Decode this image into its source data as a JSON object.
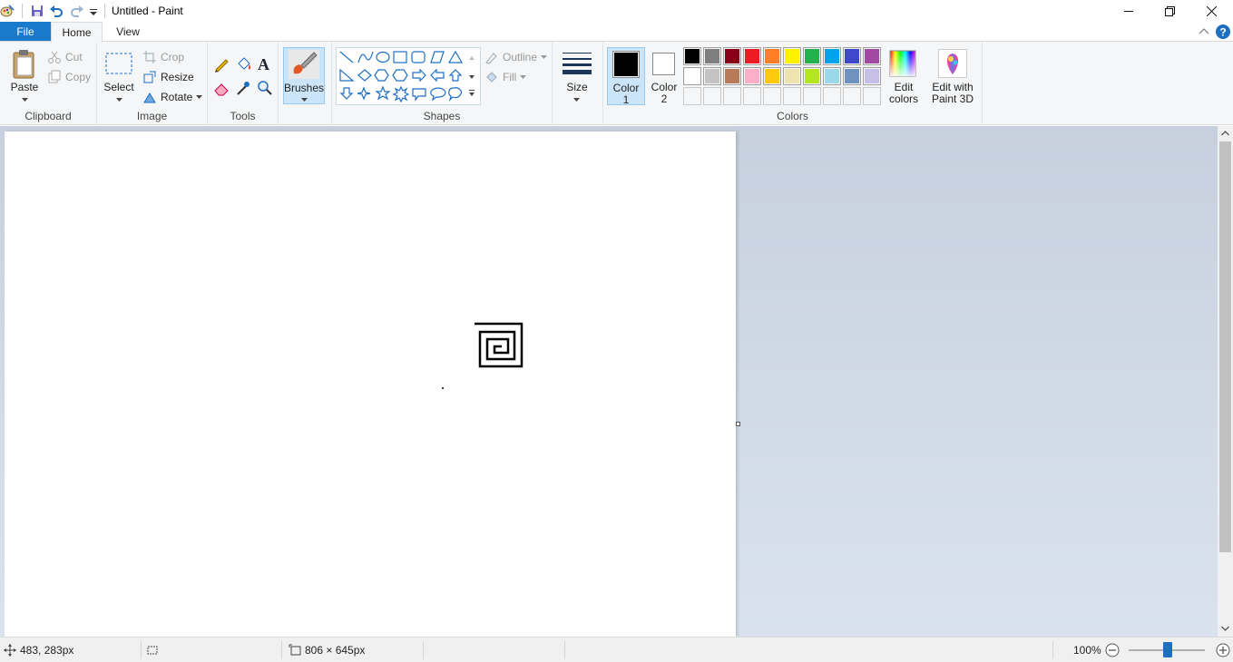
{
  "window": {
    "title": "Untitled - Paint",
    "quick_access": [
      "save-icon",
      "undo-icon",
      "redo-icon",
      "customize-icon"
    ]
  },
  "tabs": {
    "file": "File",
    "home": "Home",
    "view": "View"
  },
  "clipboard": {
    "paste": "Paste",
    "cut": "Cut",
    "copy": "Copy",
    "group": "Clipboard"
  },
  "image": {
    "select": "Select",
    "crop": "Crop",
    "resize": "Resize",
    "rotate": "Rotate",
    "group": "Image"
  },
  "tools": {
    "group": "Tools"
  },
  "brushes": {
    "label": "Brushes"
  },
  "shapes": {
    "outline": "Outline",
    "fill": "Fill",
    "group": "Shapes"
  },
  "size": {
    "label": "Size"
  },
  "colors": {
    "color1_a": "Color",
    "color1_b": "1",
    "color2_a": "Color",
    "color2_b": "2",
    "edit_a": "Edit",
    "edit_b": "colors",
    "group": "Colors",
    "color1": "#000000",
    "color2": "#ffffff",
    "palette_row1": [
      "#000000",
      "#7f7f7f",
      "#880015",
      "#ed1c24",
      "#ff7f27",
      "#fff200",
      "#22b14c",
      "#00a2e8",
      "#3f48cc",
      "#a349a4"
    ],
    "palette_row2": [
      "#ffffff",
      "#c3c3c3",
      "#b97a57",
      "#ffaec9",
      "#ffc90e",
      "#efe4b0",
      "#b5e61d",
      "#99d9ea",
      "#7092be",
      "#c8bfe7"
    ]
  },
  "paint3d": {
    "line1": "Edit with",
    "line2": "Paint 3D"
  },
  "status": {
    "cursor": "483, 283px",
    "canvas_size": "806 × 645px",
    "zoom": "100%"
  }
}
